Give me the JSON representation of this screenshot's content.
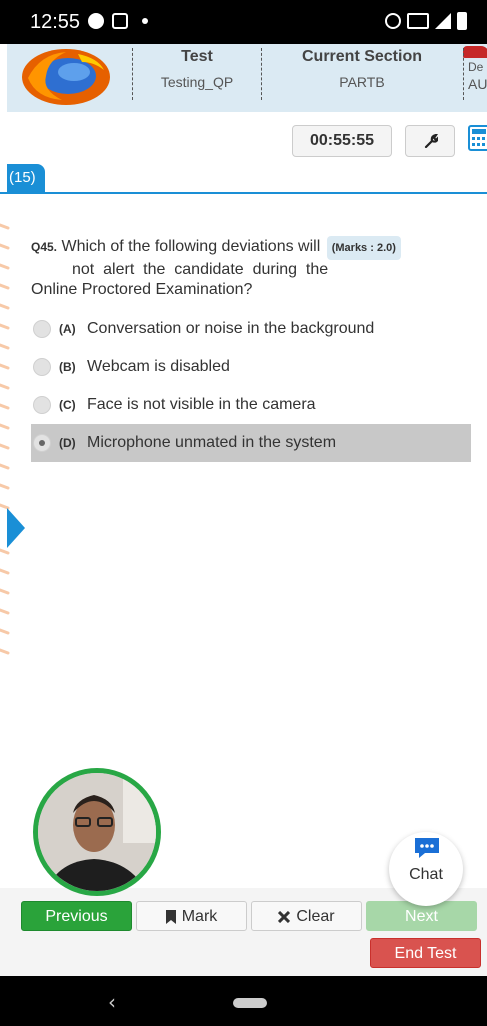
{
  "status_bar": {
    "time": "12:55"
  },
  "header": {
    "test_title": "Test",
    "test_name": "Testing_QP",
    "section_title": "Current Section",
    "section_name": "PARTB",
    "extra_title": "De",
    "extra_sub": "AU"
  },
  "toolbar": {
    "timer": "00:55:55"
  },
  "question_tab": {
    "label": "(15)"
  },
  "question": {
    "number": "Q45.",
    "line1": "Which of the following deviations will",
    "marks": "(Marks : 2.0)",
    "line2": "not  alert  the  candidate  during  the",
    "line3": "Online Proctored Examination?"
  },
  "options": [
    {
      "letter": "(A)",
      "text": "Conversation or noise in the background",
      "selected": false
    },
    {
      "letter": "(B)",
      "text": "Webcam is disabled",
      "selected": false
    },
    {
      "letter": "(C)",
      "text": "Face is not visible in the camera",
      "selected": false
    },
    {
      "letter": "(D)",
      "text": "Microphone unmated in the system",
      "selected": true
    }
  ],
  "chat": {
    "label": "Chat"
  },
  "buttons": {
    "previous": "Previous",
    "mark": "Mark",
    "clear": "Clear",
    "next": "Next",
    "end_test": "End Test"
  },
  "colors": {
    "accent_blue": "#1a8fd6",
    "green": "#2aa33a",
    "red": "#d9534f",
    "header_bg": "#dbeaf3"
  }
}
